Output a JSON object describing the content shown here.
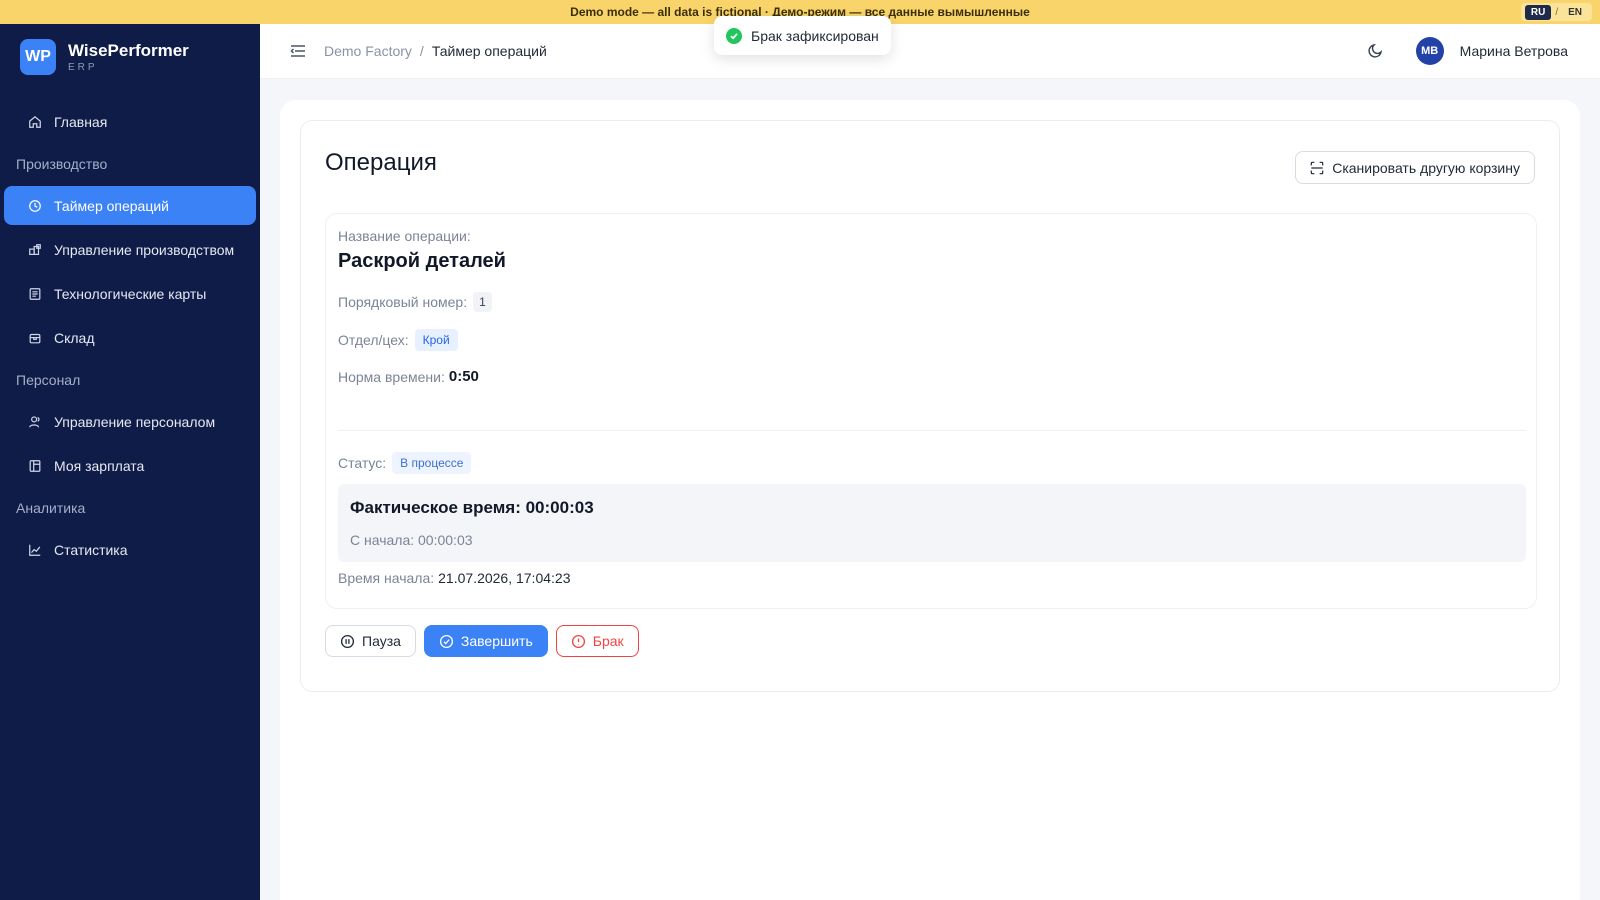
{
  "banner": {
    "text": "Demo mode — all data is fictional · Демо-режим — все данные вымышленные",
    "lang_ru": "RU",
    "lang_sep": "/",
    "lang_en": "EN"
  },
  "toast": {
    "text": "Брак зафиксирован"
  },
  "brand": {
    "logo": "WP",
    "name": "WisePerformer",
    "sub": "ERP"
  },
  "sidebar": {
    "home": "Главная",
    "section_production": "Производство",
    "timer": "Таймер операций",
    "production_mgmt": "Управление производством",
    "tech_cards": "Технологические карты",
    "warehouse": "Склад",
    "section_personnel": "Персонал",
    "personnel_mgmt": "Управление персоналом",
    "salary": "Моя зарплата",
    "section_analytics": "Аналитика",
    "statistics": "Статистика"
  },
  "header": {
    "breadcrumb_root": "Demo Factory",
    "breadcrumb_sep": "/",
    "breadcrumb_current": "Таймер операций",
    "avatar_initials": "МВ",
    "user_name": "Марина Ветрова"
  },
  "operation": {
    "title": "Операция",
    "scan_button": "Сканировать другую корзину",
    "name_label": "Название операции:",
    "name": "Раскрой деталей",
    "order_label": "Порядковый номер:",
    "order": "1",
    "dept_label": "Отдел/цех:",
    "dept": "Крой",
    "norm_label": "Норма времени:",
    "norm": "0:50",
    "status_label": "Статус:",
    "status": "В процессе",
    "actual_time": "Фактическое время: 00:00:03",
    "since_start": "С начала: 00:00:03",
    "start_label": "Время начала:",
    "start_value": "21.07.2026, 17:04:23"
  },
  "actions": {
    "pause": "Пауза",
    "finish": "Завершить",
    "defect": "Брак"
  },
  "colors": {
    "sidebar_bg": "#0f1c47",
    "accent": "#3b82f6",
    "danger": "#ef4444",
    "success": "#22c55e",
    "banner": "#f8d46a"
  }
}
